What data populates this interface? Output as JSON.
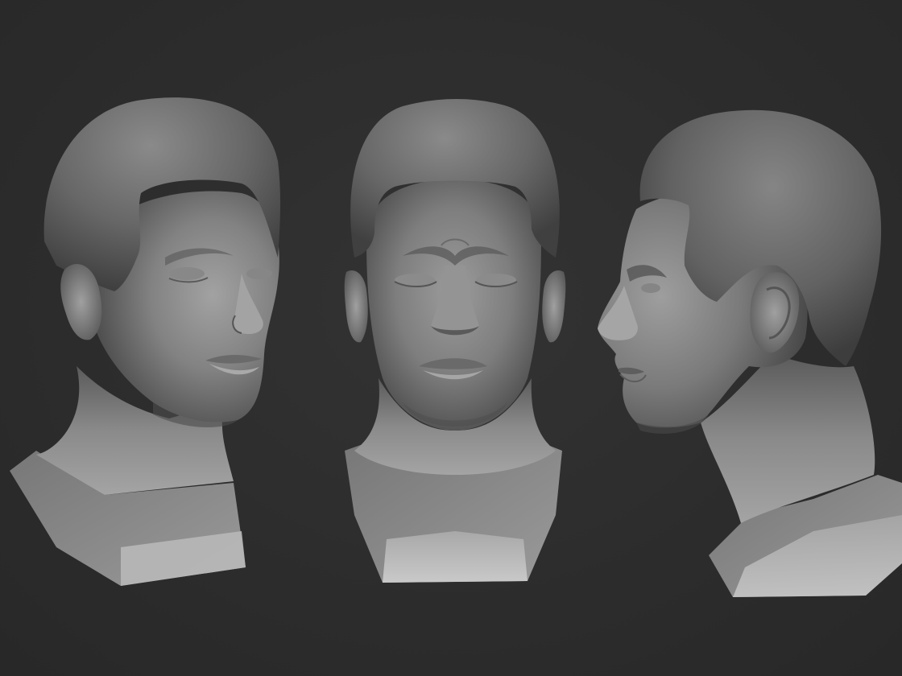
{
  "scene": {
    "background_color": "#2d2d2d",
    "material_color": "#8a8a8a",
    "views": [
      {
        "id": "three-quarter",
        "icon": "sculpt-head-three-quarter-view"
      },
      {
        "id": "front",
        "icon": "sculpt-head-front-view"
      },
      {
        "id": "profile",
        "icon": "sculpt-head-profile-view"
      }
    ]
  }
}
